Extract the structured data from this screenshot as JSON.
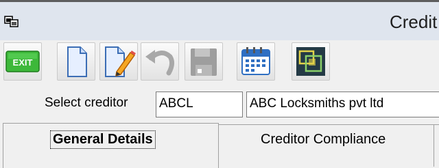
{
  "window": {
    "title": "Credit"
  },
  "toolbar": {
    "buttons": [
      {
        "name": "exit",
        "label": "EXIT",
        "enabled": true
      },
      {
        "name": "new",
        "enabled": true
      },
      {
        "name": "edit",
        "enabled": true
      },
      {
        "name": "undo",
        "enabled": false
      },
      {
        "name": "save",
        "enabled": false
      },
      {
        "name": "calendar",
        "enabled": true
      },
      {
        "name": "windows",
        "enabled": true
      }
    ]
  },
  "form": {
    "select_label": "Select creditor",
    "creditor_code": "ABCL",
    "creditor_name": "ABC Locksmiths pvt ltd"
  },
  "tabs": [
    {
      "label": "General Details",
      "active": true
    },
    {
      "label": "Creditor Compliance",
      "active": false
    }
  ],
  "colors": {
    "titlebar": "#dfe5ee",
    "exit_green": "#3db83a",
    "accent_blue": "#2f6fc2"
  }
}
